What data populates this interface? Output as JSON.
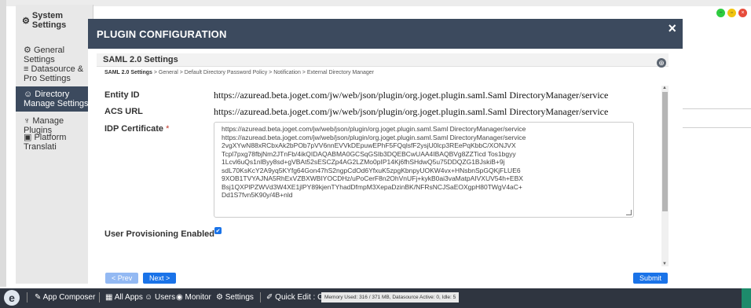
{
  "sidebar": {
    "title": "System Settings",
    "items": [
      {
        "label": "General Settings"
      },
      {
        "label": "Datasource & Pro Settings"
      },
      {
        "label": "Directory Manage Settings"
      },
      {
        "label": "Manage Plugins"
      },
      {
        "label": "Platform Translati"
      }
    ]
  },
  "modal": {
    "title": "PLUGIN CONFIGURATION",
    "close_label": "×",
    "section_title": "SAML 2.0 Settings",
    "breadcrumb": {
      "current": "SAML 2.0 Settings",
      "rest": " > General > Default Directory Password Policy > Notification > External Directory Manager"
    },
    "fields": {
      "entity_id": {
        "label": "Entity ID",
        "value": "https://azuread.beta.joget.com/jw/web/json/plugin/org.joget.plugin.saml.Saml DirectoryManager/service"
      },
      "acs_url": {
        "label": "ACS URL",
        "value": "https://azuread.beta.joget.com/jw/web/json/plugin/org.joget.plugin.saml.Saml DirectoryManager/service"
      },
      "idp_certificate": {
        "label": "IDP Certificate",
        "required_mark": "*",
        "lines": [
          "https://azuread.beta.joget.com/jw/web/json/plugin/org.joget.plugin.saml.Saml DirectoryManager/service",
          "https://azuread.beta.joget.com/jw/web/json/plugin/org.joget.plugin.saml.Saml DirectoryManager/service",
          "2vgXYwN88xRCbxAk2bPOb7pVV6nnEVVkDEpuwEPhF5FQqlsfF2ysjU0lcp3REePqKbbC/XONJVX",
          "Tcpl7pxg78fbjNm2JTnFb/4ikQIDAQABMA0GCSqGSIb3DQEBCwUAA4IBAQBVg8ZZTicd Tos1bgyy",
          "1Lcvl6uQs1nlByy8sd+gVBAt52sESCZp4AG2LZMo0pIP14Kj6fhSHdwQ5u75DDQZG1BJskiB+9j",
          "sdL70KsKcY2A9yq5KYfg64Gon47hS2ngpCdOd6YfxuK5zpgKbnpyUOKW4vx+HNsbnSpGQKjFLUE6",
          "9XOB1TVYAJNA5RhExVZBXWBIYOCDHz/uPoCerF8n2OhVnUFj+kykB0ai3vaMatpAIVXUV54h+EBX",
          "Bsj1QXPlPZWVd3W4XE1jlPY89kjenTYhadDfmpM3XepaDzinBK/NFRsNCJSaEOXgpH80TWgV4aC+",
          "Dd1S7fvn5K90y/4B+nld"
        ]
      },
      "user_provisioning": {
        "label": "User Provisioning Enabled",
        "checked": true
      }
    },
    "buttons": {
      "prev": "< Prev",
      "next": "Next >",
      "submit": "Submit"
    }
  },
  "taskbar": {
    "items": [
      {
        "label": "App Composer"
      },
      {
        "label": "All Apps"
      },
      {
        "label": "Users"
      },
      {
        "label": "Monitor"
      },
      {
        "label": "Settings"
      },
      {
        "label": "Quick Edit : On"
      }
    ],
    "memory_status": "Memory Used: 316 / 371 MB, Datasource Active: 0, Idle: 5"
  },
  "colors": {
    "header_bg": "#3c4a5e",
    "accent": "#1a73e8",
    "taskbar_bg": "#2f3540"
  }
}
